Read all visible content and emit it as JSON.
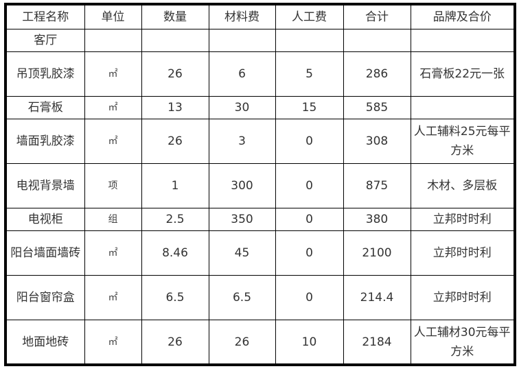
{
  "table": {
    "headers": [
      "工程名称",
      "单位",
      "数量",
      "材料费",
      "人工费",
      "合计",
      "品牌及合价"
    ],
    "rows": [
      {
        "name": "客厅",
        "unit": "",
        "qty": "",
        "material": "",
        "labor": "",
        "total": "",
        "brand": ""
      },
      {
        "name": "吊顶乳胶漆",
        "unit": "㎡",
        "qty": "26",
        "material": "6",
        "labor": "5",
        "total": "286",
        "brand": "石膏板22元一张"
      },
      {
        "name": "石膏板",
        "unit": "㎡",
        "qty": "13",
        "material": "30",
        "labor": "15",
        "total": "585",
        "brand": ""
      },
      {
        "name": "墙面乳胶漆",
        "unit": "㎡",
        "qty": "26",
        "material": "3",
        "labor": "0",
        "total": "308",
        "brand": "人工辅料25元每平方米"
      },
      {
        "name": "电视背景墙",
        "unit": "项",
        "qty": "1",
        "material": "300",
        "labor": "0",
        "total": "875",
        "brand": "木材、多层板"
      },
      {
        "name": "电视柜",
        "unit": "组",
        "qty": "2.5",
        "material": "350",
        "labor": "0",
        "total": "380",
        "brand": "立邦时时利"
      },
      {
        "name": "阳台墙面墙砖",
        "unit": "㎡",
        "qty": "8.46",
        "material": "45",
        "labor": "0",
        "total": "2100",
        "brand": "立邦时时利"
      },
      {
        "name": "阳台窗帘盒",
        "unit": "㎡",
        "qty": "6.5",
        "material": "6.5",
        "labor": "0",
        "total": "214.4",
        "brand": "立邦时时利"
      },
      {
        "name": "地面地砖",
        "unit": "㎡",
        "qty": "26",
        "material": "26",
        "labor": "10",
        "total": "2184",
        "brand": "人工辅材30元每平方米"
      }
    ]
  }
}
